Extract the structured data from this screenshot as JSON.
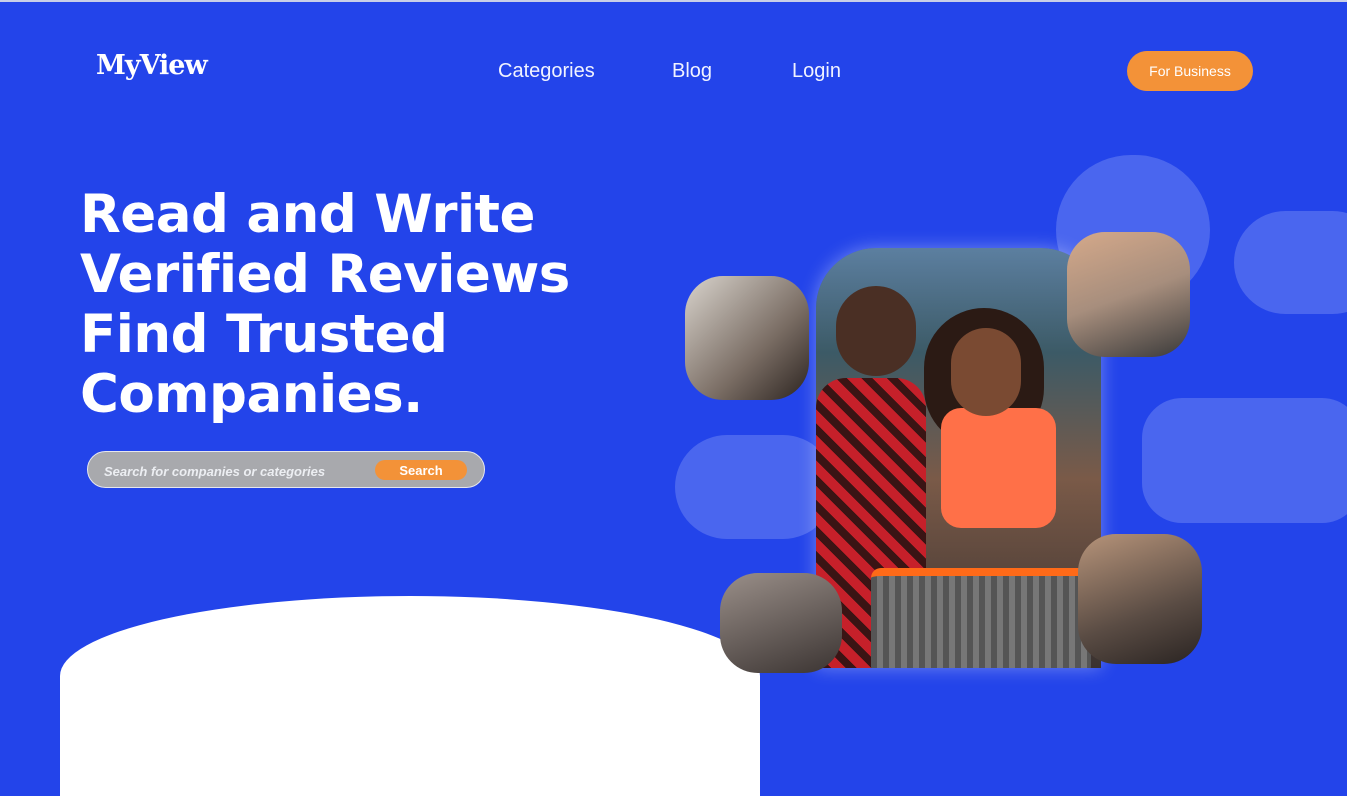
{
  "brand": {
    "logo": "MyView"
  },
  "nav": {
    "items": [
      "Categories",
      "Blog",
      "Login"
    ]
  },
  "header": {
    "cta_label": "For Business"
  },
  "hero": {
    "lines": [
      "Read and Write",
      "Verified Reviews",
      "Find Trusted",
      "Companies."
    ]
  },
  "search": {
    "placeholder": "Search for companies or categories",
    "button_label": "Search"
  },
  "colors": {
    "background": "#2344ea",
    "accent": "#f39238",
    "blob": "#4a66ef"
  }
}
